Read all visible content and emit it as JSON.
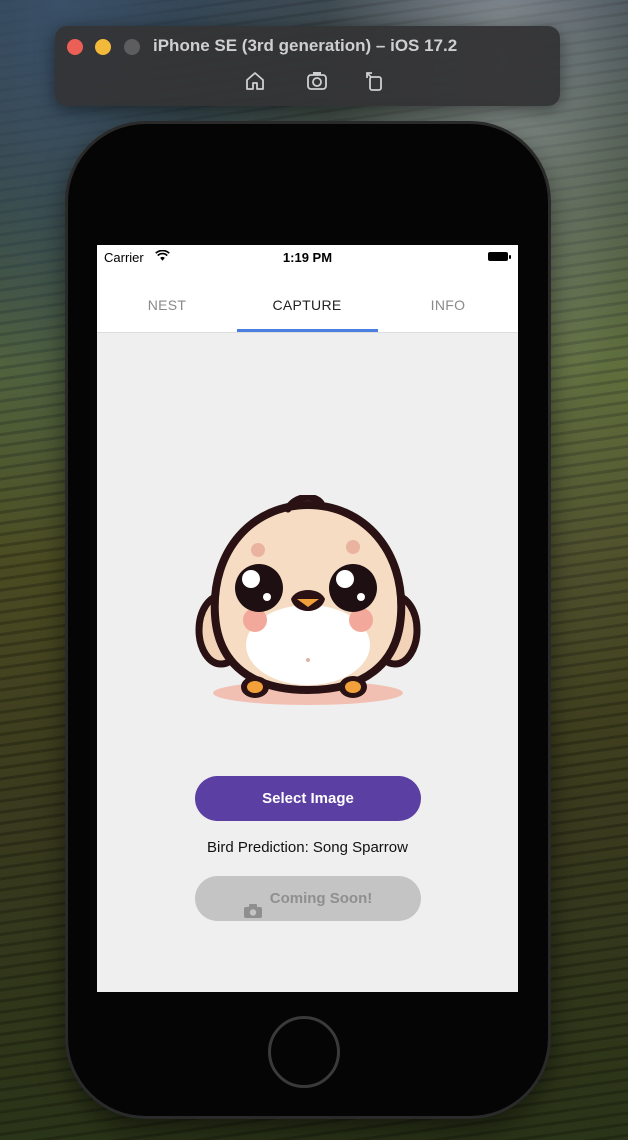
{
  "simulator": {
    "title": "iPhone SE (3rd generation) – iOS 17.2",
    "tools": [
      "home-icon",
      "screenshot-icon",
      "rotate-icon"
    ]
  },
  "statusbar": {
    "carrier": "Carrier",
    "time": "1:19 PM"
  },
  "tabs": [
    {
      "label": "NEST",
      "active": false
    },
    {
      "label": "CAPTURE",
      "active": true
    },
    {
      "label": "INFO",
      "active": false
    }
  ],
  "main": {
    "mascot": "bird-mascot-image",
    "select_button": "Select Image",
    "prediction_text": "Bird Prediction: Song Sparrow",
    "coming_soon_button": "Coming Soon!",
    "coming_soon_icon": "camera-icon"
  },
  "colors": {
    "accent": "#5b3fa3",
    "tab_indicator": "#4a7fe0",
    "disabled_button": "#c4c4c4"
  }
}
